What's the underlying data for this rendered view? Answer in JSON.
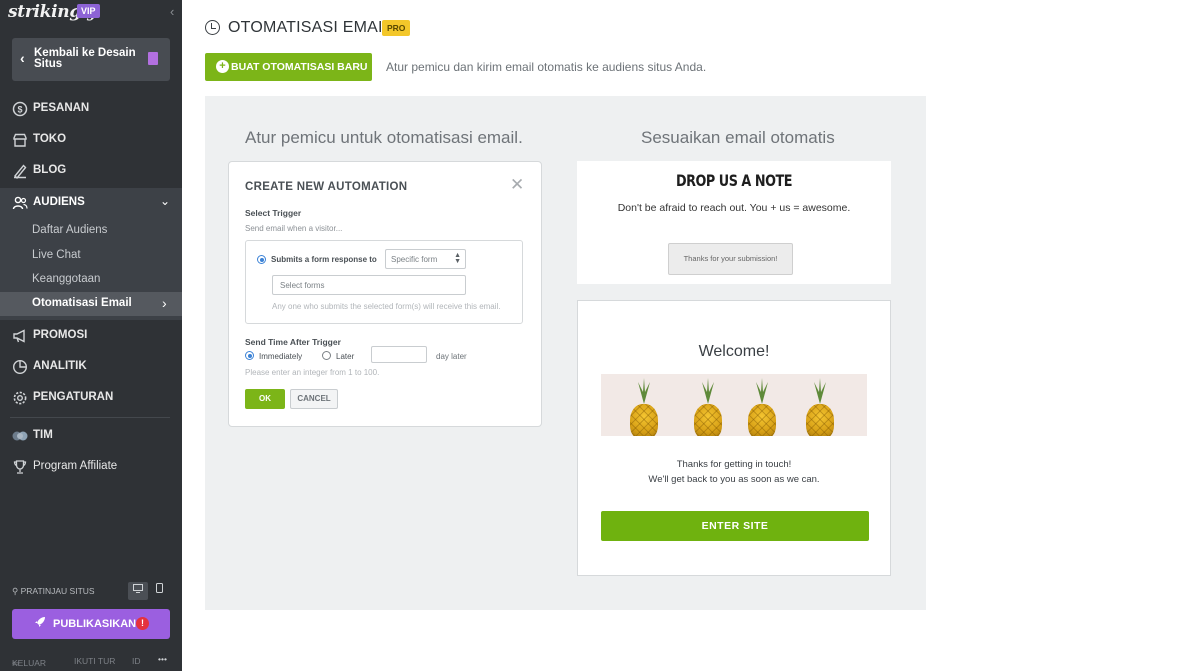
{
  "sidebar": {
    "brand": "strikingly",
    "badge": "VIP",
    "back_label": "Kembali ke Desain Situs",
    "nav": [
      {
        "label": "PESANAN",
        "icon": "dollar-circle-icon"
      },
      {
        "label": "TOKO",
        "icon": "store-icon"
      },
      {
        "label": "BLOG",
        "icon": "pen-icon"
      },
      {
        "label": "AUDIENS",
        "icon": "users-icon"
      },
      {
        "label": "PROMOSI",
        "icon": "megaphone-icon"
      },
      {
        "label": "ANALITIK",
        "icon": "pie-chart-icon"
      },
      {
        "label": "PENGATURAN",
        "icon": "gear-icon"
      },
      {
        "label": "TIM",
        "icon": "team-avatar-icon"
      },
      {
        "label": "Program Affiliate",
        "icon": "trophy-icon"
      }
    ],
    "audiens_sub": [
      "Daftar Audiens",
      "Live Chat",
      "Keanggotaan",
      "Otomatisasi Email"
    ],
    "preview_label": "PRATINJAU SITUS",
    "publish_label": "PUBLIKASIKAN",
    "footer": {
      "logout": "KELUAR",
      "tour": "IKUTI TUR",
      "lang": "ID",
      "more": "•••"
    }
  },
  "header": {
    "title": "OTOMATISASI EMAIL",
    "badge": "PRO",
    "new_button": "BUAT OTOMATISASI BARU",
    "description": "Atur pemicu dan kirim email otomatis ke audiens situs Anda."
  },
  "left_column": {
    "title": "Atur pemicu untuk otomatisasi email.",
    "modal": {
      "title": "CREATE NEW AUTOMATION",
      "select_trigger": "Select Trigger",
      "send_when": "Send email when a visitor...",
      "radio_label": "Submits a form response to",
      "form_select": "Specific form",
      "forms_placeholder": "Select forms",
      "forms_hint": "Any one who submits the selected form(s) will receive this email.",
      "send_time": "Send Time After Trigger",
      "immediately": "Immediately",
      "later": "Later",
      "day_later": "day later",
      "integer_hint": "Please enter an integer  from 1 to 100.",
      "ok": "OK",
      "cancel": "CANCEL"
    }
  },
  "right_column": {
    "title": "Sesuaikan email otomatis",
    "form_preview": {
      "heading": "DROP US A NOTE",
      "subtext": "Don't be afraid to reach out. You + us = awesome.",
      "thanks": "Thanks for your submission!"
    },
    "email_preview": {
      "welcome": "Welcome!",
      "line1": "Thanks for getting in touch!",
      "line2": "We'll get back to you as soon as we can.",
      "button": "ENTER SITE"
    }
  },
  "colors": {
    "sidebar_bg": "#2f3236",
    "accent_green": "#7cb518",
    "publish_purple": "#9b5fe0",
    "pro_yellow": "#f3c72a",
    "panel_bg": "#eef0f1"
  }
}
